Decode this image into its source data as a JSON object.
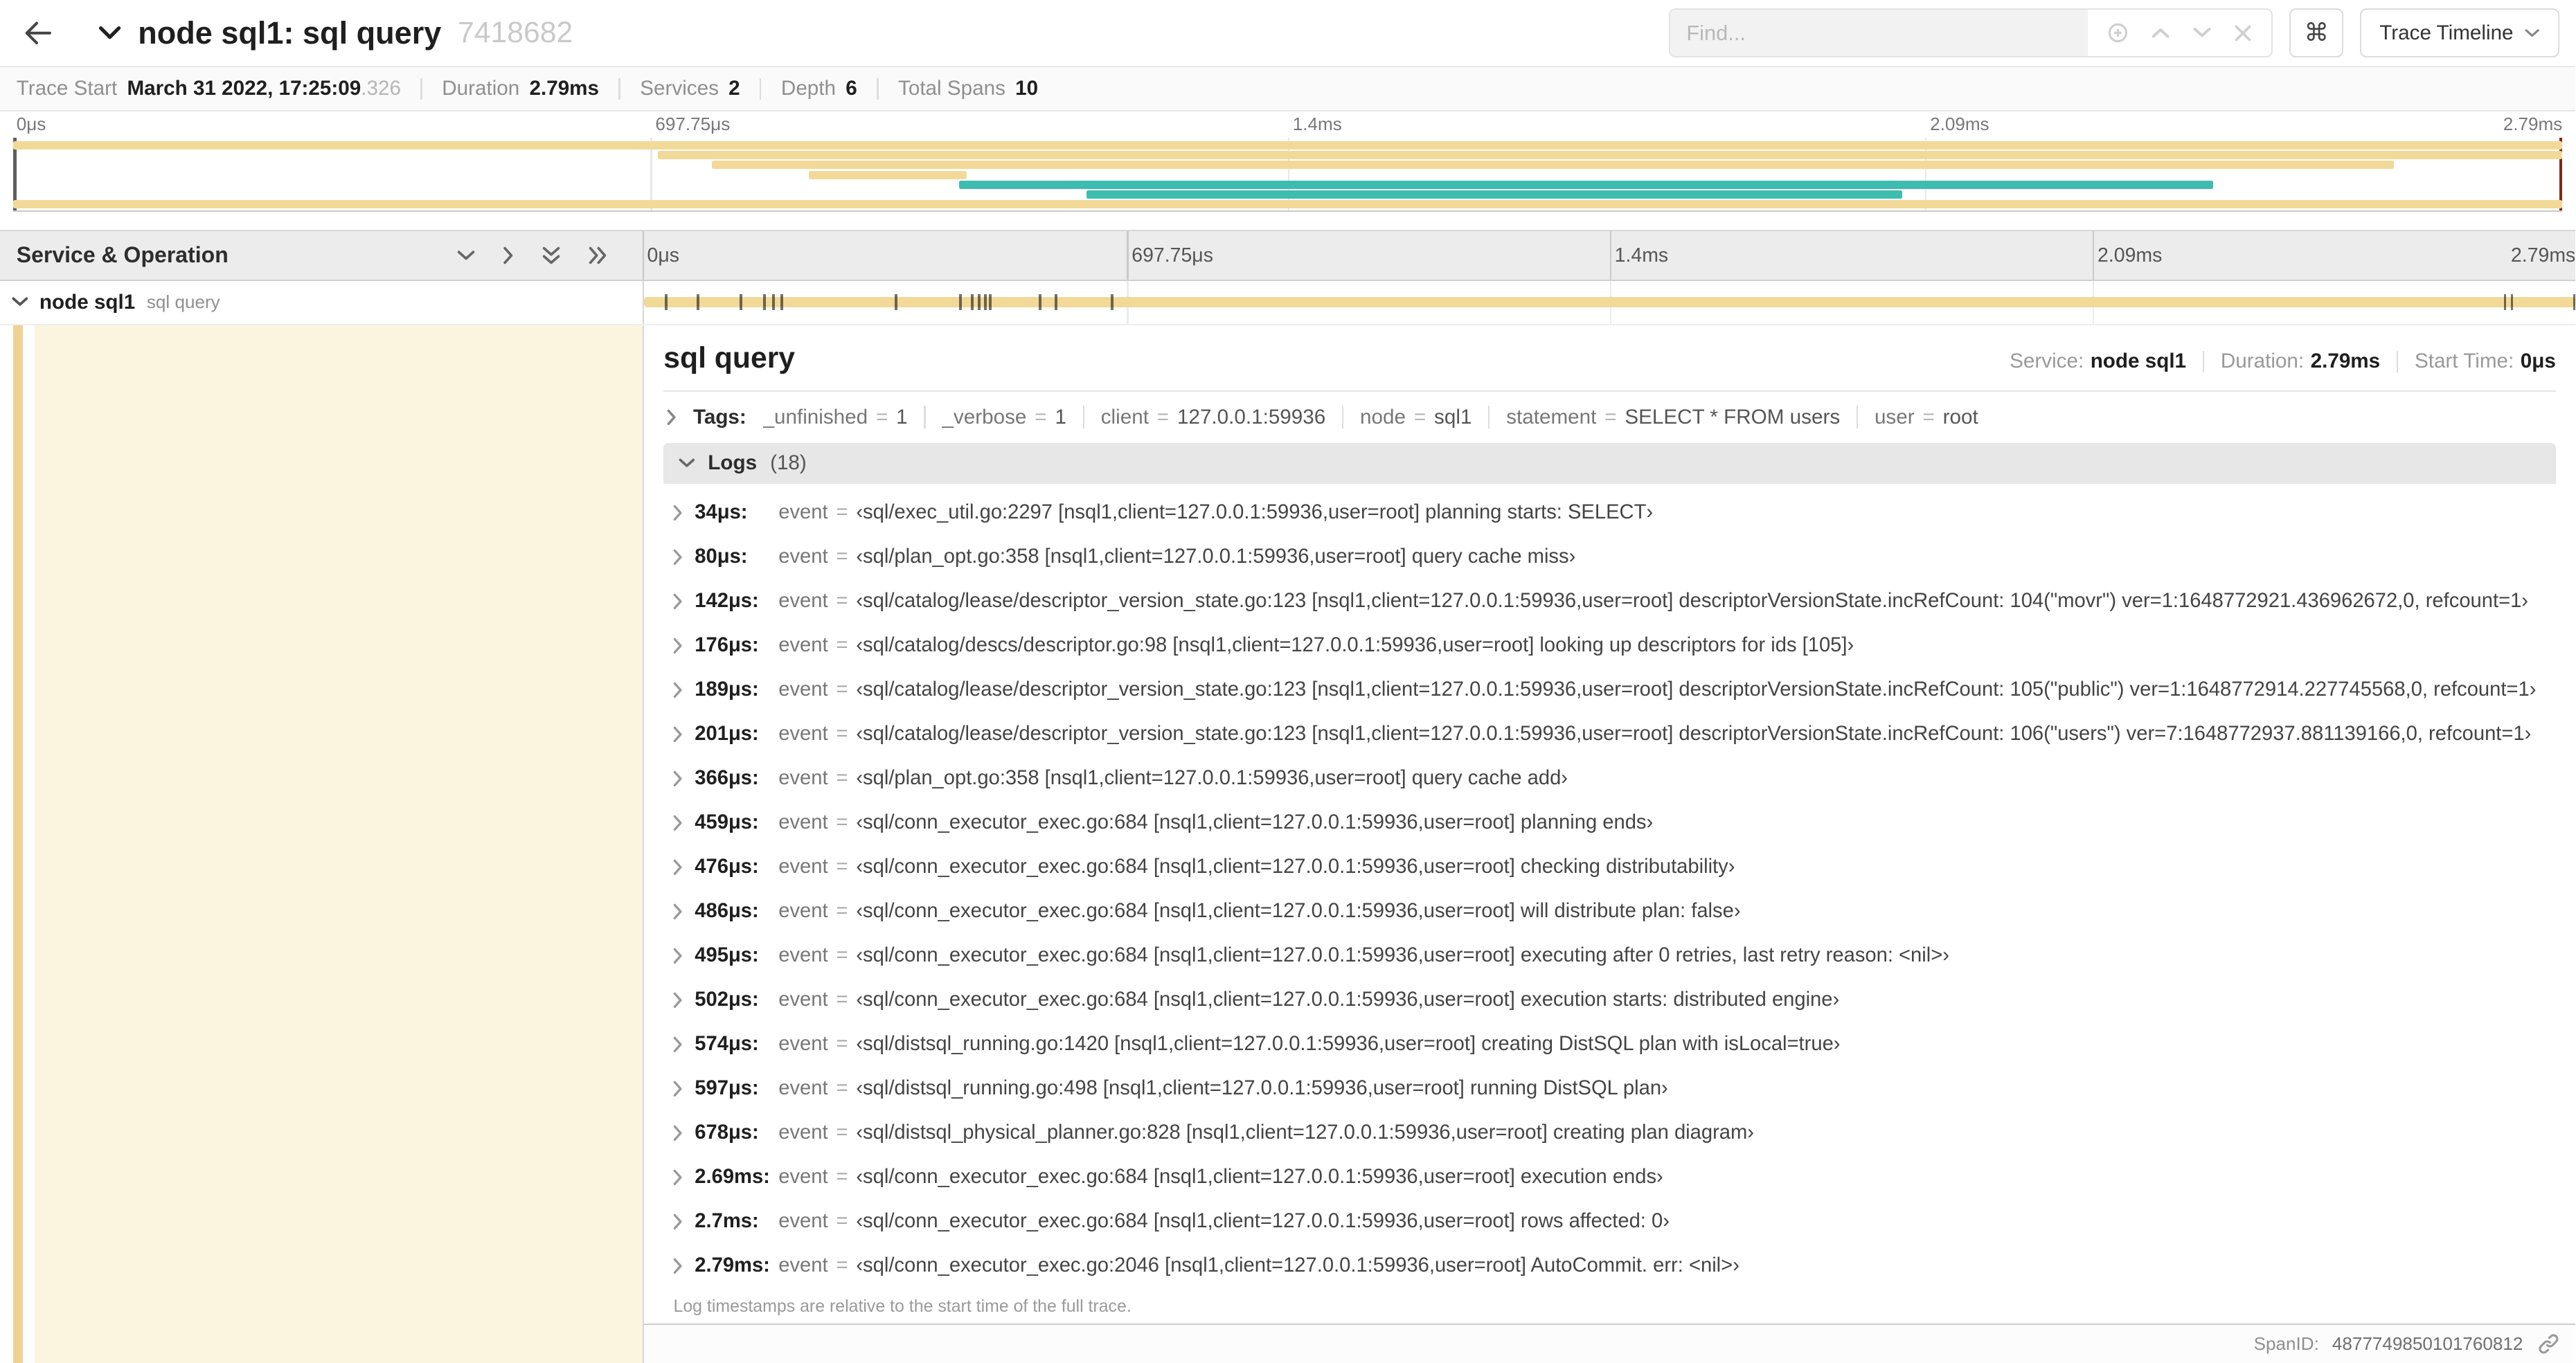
{
  "header": {
    "title": "node sql1: sql query",
    "trace_id": "7418682",
    "find_placeholder": "Find...",
    "kbd_glyph": "⌘",
    "view_dropdown_label": "Trace Timeline"
  },
  "trace_stats": {
    "items": [
      {
        "label": "Trace Start",
        "value": "March 31 2022, 17:25:09",
        "suffix": ".326"
      },
      {
        "label": "Duration",
        "value": "2.79ms"
      },
      {
        "label": "Services",
        "value": "2"
      },
      {
        "label": "Depth",
        "value": "6"
      },
      {
        "label": "Total Spans",
        "value": "10"
      }
    ]
  },
  "minimap": {
    "tick_labels": [
      "0μs",
      "697.75μs",
      "1.4ms",
      "2.09ms",
      "2.79ms"
    ],
    "colors": {
      "tan": "#f2d998",
      "teal": "#3dbcb0"
    },
    "spans": [
      {
        "row": 0,
        "start": 0,
        "end": 100,
        "color": "tan"
      },
      {
        "row": 1,
        "start": 25.3,
        "end": 100,
        "color": "tan"
      },
      {
        "row": 2,
        "start": 27.4,
        "end": 93.4,
        "color": "tan"
      },
      {
        "row": 3,
        "start": 31.2,
        "end": 37.4,
        "color": "tan"
      },
      {
        "row": 4,
        "start": 37.1,
        "end": 86.3,
        "color": "teal"
      },
      {
        "row": 5,
        "start": 42.1,
        "end": 74.1,
        "color": "teal"
      },
      {
        "row": 6,
        "start": 0,
        "end": 100,
        "color": "tan"
      }
    ]
  },
  "timeline": {
    "left_header": "Service & Operation",
    "ruler_labels": [
      "0μs",
      "697.75μs",
      "1.4ms",
      "2.09ms",
      "2.79ms"
    ],
    "row": {
      "service": "node sql1",
      "operation": "sql query"
    },
    "total_us": 2790,
    "tick_times_us": [
      34,
      80,
      142,
      176,
      189,
      201,
      366,
      459,
      476,
      486,
      495,
      502,
      574,
      597,
      678,
      2690,
      2700,
      2790
    ]
  },
  "detail": {
    "title": "sql query",
    "service_label": "Service:",
    "service_value": "node sql1",
    "duration_label": "Duration:",
    "duration_value": "2.79ms",
    "start_time_label": "Start Time:",
    "start_time_value": "0μs",
    "eq": "=",
    "tags_label": "Tags:",
    "tags": [
      {
        "key": "_unfinished",
        "value": "1"
      },
      {
        "key": "_verbose",
        "value": "1"
      },
      {
        "key": "client",
        "value": "127.0.0.1:59936"
      },
      {
        "key": "node",
        "value": "sql1"
      },
      {
        "key": "statement",
        "value": "SELECT * FROM users"
      },
      {
        "key": "user",
        "value": "root"
      }
    ],
    "logs_label": "Logs",
    "logs_count": "(18)",
    "logs": [
      {
        "time": "34μs:",
        "key": "event",
        "value": "‹sql/exec_util.go:2297 [nsql1,client=127.0.0.1:59936,user=root] planning starts: SELECT›"
      },
      {
        "time": "80μs:",
        "key": "event",
        "value": "‹sql/plan_opt.go:358 [nsql1,client=127.0.0.1:59936,user=root] query cache miss›"
      },
      {
        "time": "142μs:",
        "key": "event",
        "value": "‹sql/catalog/lease/descriptor_version_state.go:123 [nsql1,client=127.0.0.1:59936,user=root] descriptorVersionState.incRefCount: 104(\"movr\") ver=1:1648772921.436962672,0, refcount=1›"
      },
      {
        "time": "176μs:",
        "key": "event",
        "value": "‹sql/catalog/descs/descriptor.go:98 [nsql1,client=127.0.0.1:59936,user=root] looking up descriptors for ids [105]›"
      },
      {
        "time": "189μs:",
        "key": "event",
        "value": "‹sql/catalog/lease/descriptor_version_state.go:123 [nsql1,client=127.0.0.1:59936,user=root] descriptorVersionState.incRefCount: 105(\"public\") ver=1:1648772914.227745568,0, refcount=1›"
      },
      {
        "time": "201μs:",
        "key": "event",
        "value": "‹sql/catalog/lease/descriptor_version_state.go:123 [nsql1,client=127.0.0.1:59936,user=root] descriptorVersionState.incRefCount: 106(\"users\") ver=7:1648772937.881139166,0, refcount=1›"
      },
      {
        "time": "366μs:",
        "key": "event",
        "value": "‹sql/plan_opt.go:358 [nsql1,client=127.0.0.1:59936,user=root] query cache add›"
      },
      {
        "time": "459μs:",
        "key": "event",
        "value": "‹sql/conn_executor_exec.go:684 [nsql1,client=127.0.0.1:59936,user=root] planning ends›"
      },
      {
        "time": "476μs:",
        "key": "event",
        "value": "‹sql/conn_executor_exec.go:684 [nsql1,client=127.0.0.1:59936,user=root] checking distributability›"
      },
      {
        "time": "486μs:",
        "key": "event",
        "value": "‹sql/conn_executor_exec.go:684 [nsql1,client=127.0.0.1:59936,user=root] will distribute plan: false›"
      },
      {
        "time": "495μs:",
        "key": "event",
        "value": "‹sql/conn_executor_exec.go:684 [nsql1,client=127.0.0.1:59936,user=root] executing after 0 retries, last retry reason: <nil>›"
      },
      {
        "time": "502μs:",
        "key": "event",
        "value": "‹sql/conn_executor_exec.go:684 [nsql1,client=127.0.0.1:59936,user=root] execution starts: distributed engine›"
      },
      {
        "time": "574μs:",
        "key": "event",
        "value": "‹sql/distsql_running.go:1420 [nsql1,client=127.0.0.1:59936,user=root] creating DistSQL plan with isLocal=true›"
      },
      {
        "time": "597μs:",
        "key": "event",
        "value": "‹sql/distsql_running.go:498 [nsql1,client=127.0.0.1:59936,user=root] running DistSQL plan›"
      },
      {
        "time": "678μs:",
        "key": "event",
        "value": "‹sql/distsql_physical_planner.go:828 [nsql1,client=127.0.0.1:59936,user=root] creating plan diagram›"
      },
      {
        "time": "2.69ms:",
        "key": "event",
        "value": "‹sql/conn_executor_exec.go:684 [nsql1,client=127.0.0.1:59936,user=root] execution ends›"
      },
      {
        "time": "2.7ms:",
        "key": "event",
        "value": "‹sql/conn_executor_exec.go:684 [nsql1,client=127.0.0.1:59936,user=root] rows affected: 0›"
      },
      {
        "time": "2.79ms:",
        "key": "event",
        "value": "‹sql/conn_executor_exec.go:2046 [nsql1,client=127.0.0.1:59936,user=root] AutoCommit. err: <nil>›"
      }
    ],
    "logs_footnote": "Log timestamps are relative to the start time of the full trace.",
    "span_id_label": "SpanID:",
    "span_id_value": "4877749850101760812"
  }
}
